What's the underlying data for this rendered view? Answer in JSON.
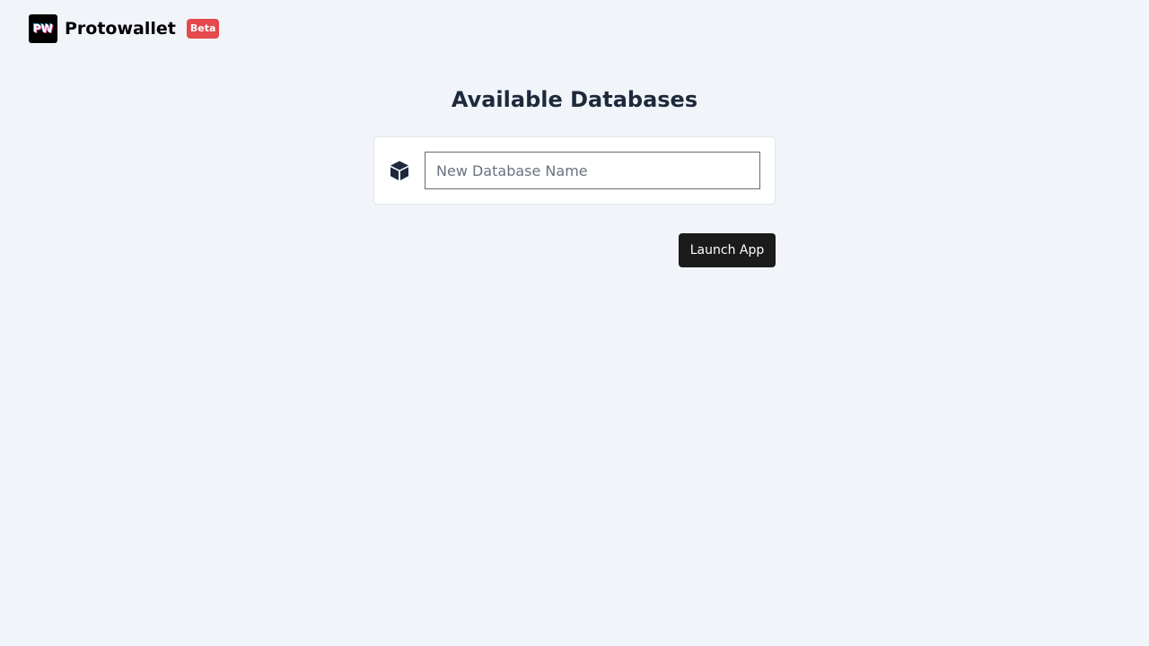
{
  "brand": {
    "logo_text": "PW",
    "name": "Protowallet",
    "badge": "Beta"
  },
  "main": {
    "title_glyph_left": "",
    "title": "Available Databases",
    "title_glyph_right": "",
    "new_db_input": {
      "value": "",
      "placeholder": "New Database Name",
      "icon": "cube-icon"
    },
    "launch_button_label": "Launch App"
  },
  "colors": {
    "background": "#f1f4f8",
    "badge": "#e5484d",
    "button": "#1b1b1b",
    "title_text": "#1e293b"
  }
}
